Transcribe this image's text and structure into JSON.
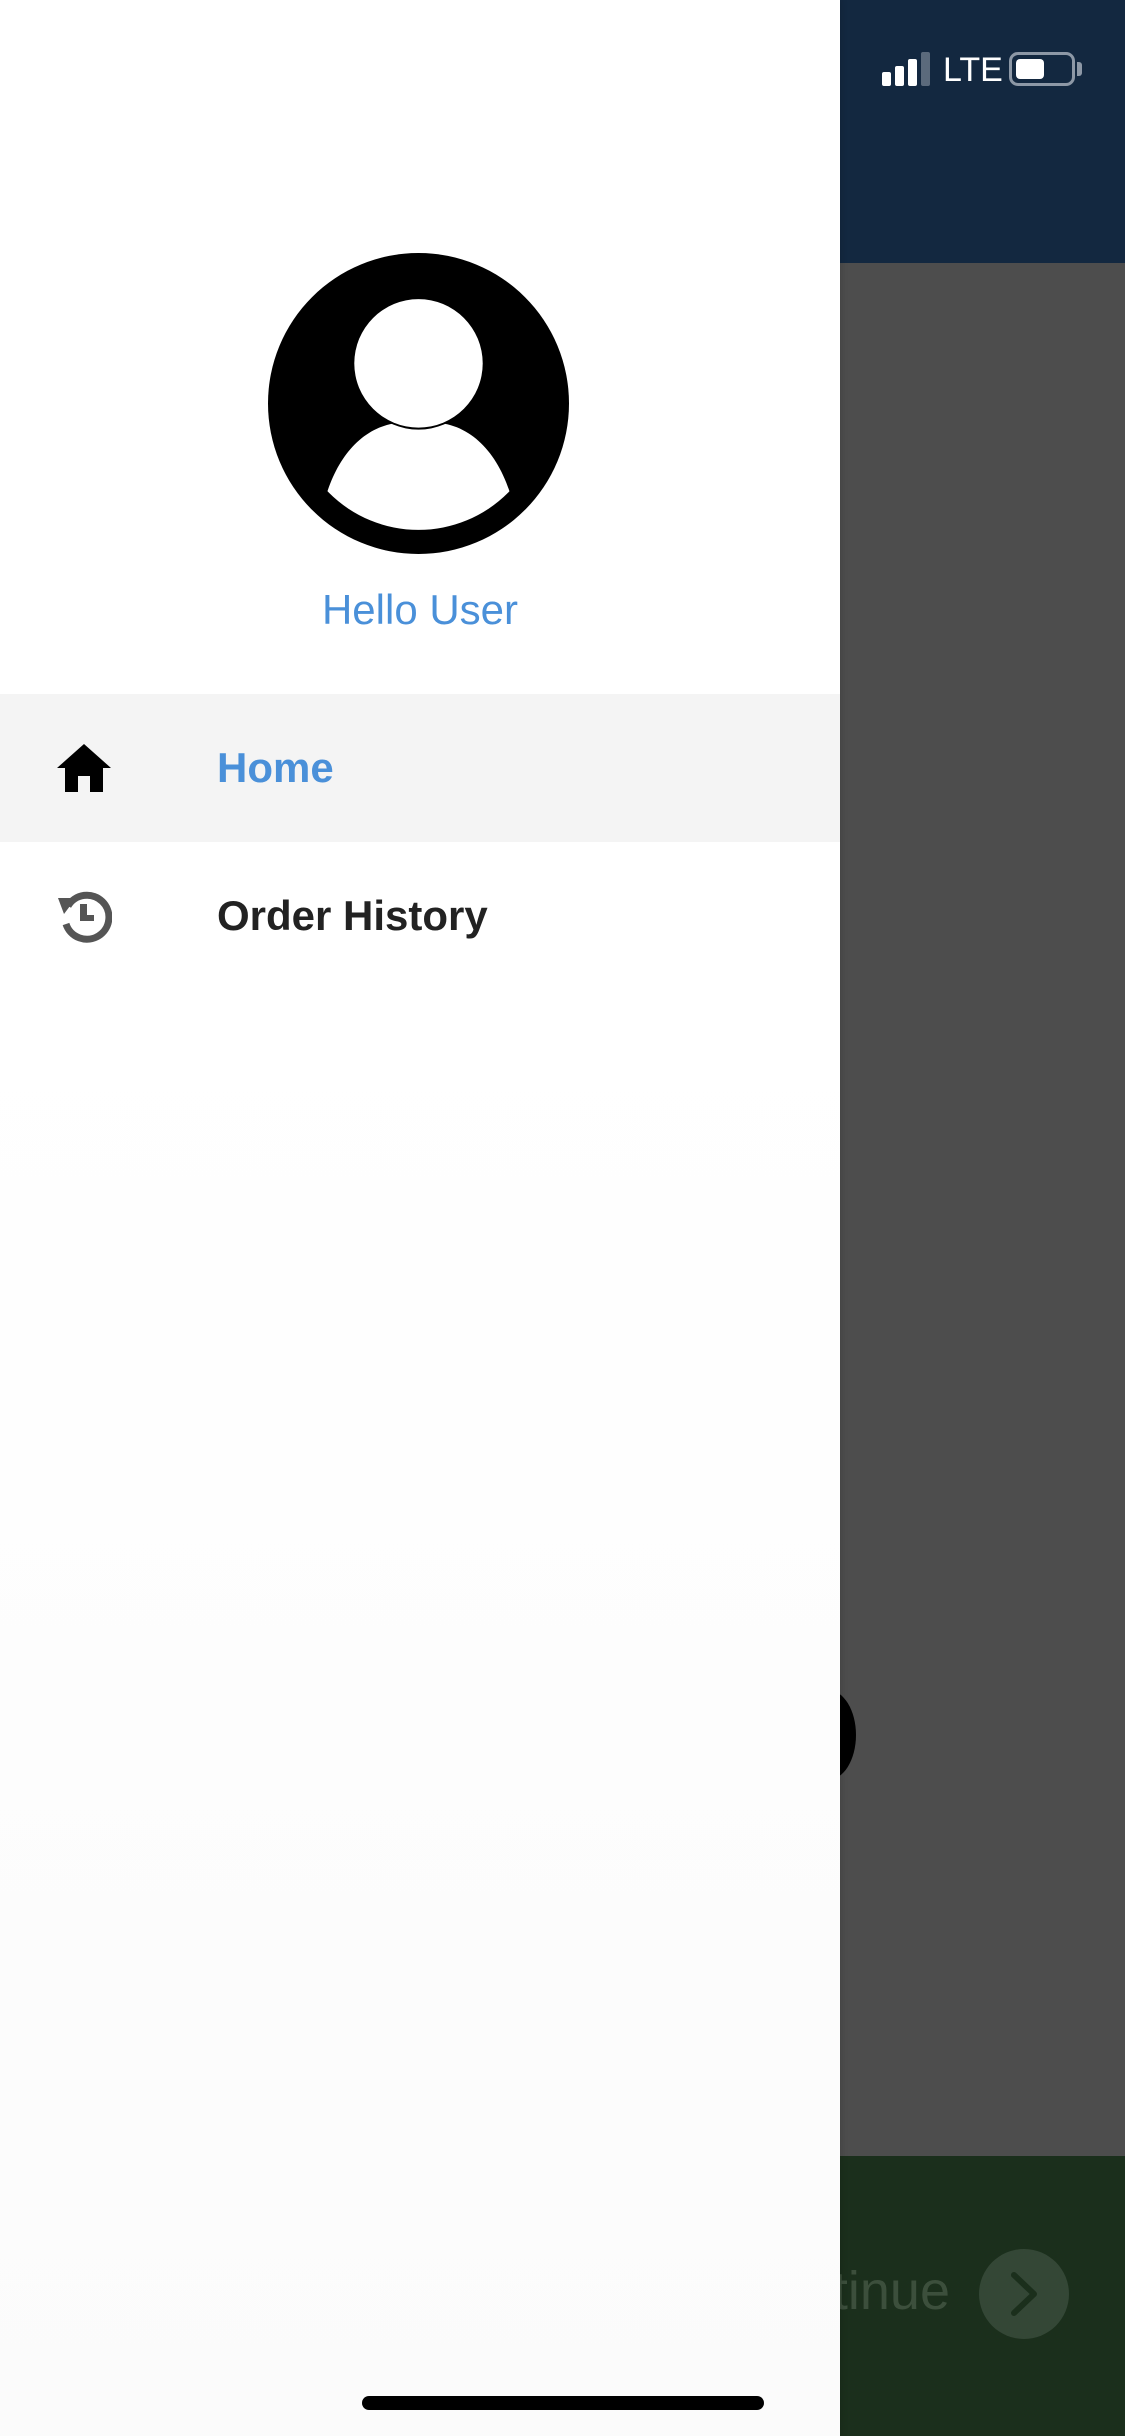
{
  "status_bar": {
    "network": "LTE",
    "signal_bars": 3,
    "battery_level": 0.5
  },
  "drawer": {
    "greeting": "Hello User",
    "avatar_icon": "user-avatar-icon",
    "items": [
      {
        "label": "Home",
        "icon": "home-icon",
        "active": true,
        "color": "#4a90d9"
      },
      {
        "label": "Order History",
        "icon": "history-icon",
        "active": false,
        "color": "#222222"
      }
    ]
  },
  "background_app": {
    "header_color": "#132840",
    "footer_color": "#1b2f1c",
    "continue_label": "tinue"
  }
}
